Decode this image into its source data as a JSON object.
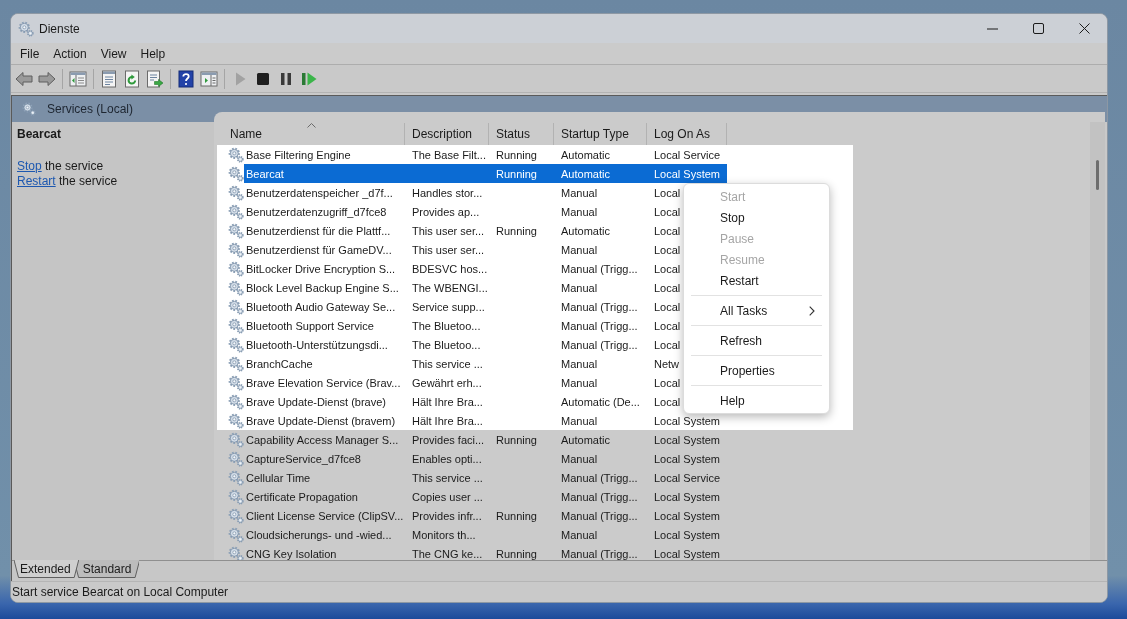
{
  "window": {
    "title": "Dienste"
  },
  "menu_bar": [
    "File",
    "Action",
    "View",
    "Help"
  ],
  "toolbar": {
    "groups": [
      {
        "buttons": [
          {
            "kind": "back",
            "disabled": false
          },
          {
            "kind": "forward",
            "disabled": false
          }
        ]
      },
      {
        "buttons": [
          {
            "kind": "console_tree",
            "disabled": false
          }
        ]
      },
      {
        "buttons": [
          {
            "kind": "properties",
            "disabled": false
          },
          {
            "kind": "refresh",
            "disabled": false
          },
          {
            "kind": "export",
            "disabled": false
          }
        ]
      },
      {
        "buttons": [
          {
            "kind": "help",
            "disabled": false
          },
          {
            "kind": "action_pane",
            "disabled": false
          }
        ]
      },
      {
        "buttons": [
          {
            "kind": "start",
            "disabled": true
          },
          {
            "kind": "stop",
            "disabled": false
          },
          {
            "kind": "pause",
            "disabled": false
          },
          {
            "kind": "restart",
            "disabled": false
          }
        ]
      }
    ]
  },
  "scope_header": {
    "title": "Services (Local)"
  },
  "detail_panel": {
    "title": "Bearcat",
    "actions": [
      {
        "link": "Stop",
        "text": "the service"
      },
      {
        "link": "Restart",
        "text": "the service"
      }
    ]
  },
  "table": {
    "columns": [
      {
        "label": "Name",
        "sorted": true
      },
      {
        "label": "Description",
        "sorted": false
      },
      {
        "label": "Status",
        "sorted": false
      },
      {
        "label": "Startup Type",
        "sorted": false
      },
      {
        "label": "Log On As",
        "sorted": false
      }
    ],
    "rows": [
      {
        "name": "Base Filtering Engine",
        "description": "The Base Filt...",
        "status": "Running",
        "startup_type": "Automatic",
        "log_on_as": "Local Service",
        "selected": false,
        "highlighted": true
      },
      {
        "name": "Bearcat",
        "status": "Running",
        "startup_type": "Automatic",
        "log_on_as": "Local System",
        "selected": true,
        "highlighted": true
      },
      {
        "name": "Benutzerdatenspeicher _d7f...",
        "description": "Handles stor...",
        "startup_type": "Manual",
        "log_on_as": "Local",
        "selected": false,
        "highlighted": true
      },
      {
        "name": "Benutzerdatenzugriff_d7fce8",
        "description": "Provides ap...",
        "startup_type": "Manual",
        "log_on_as": "Local",
        "selected": false,
        "highlighted": true
      },
      {
        "name": "Benutzerdienst für die Plattf...",
        "description": "This user ser...",
        "status": "Running",
        "startup_type": "Automatic",
        "log_on_as": "Local",
        "selected": false,
        "highlighted": true
      },
      {
        "name": "Benutzerdienst für GameDV...",
        "description": "This user ser...",
        "startup_type": "Manual",
        "log_on_as": "Local",
        "selected": false,
        "highlighted": true
      },
      {
        "name": "BitLocker Drive Encryption S...",
        "description": "BDESVC hos...",
        "startup_type": "Manual (Trigg...",
        "log_on_as": "Local",
        "selected": false,
        "highlighted": true
      },
      {
        "name": "Block Level Backup Engine S...",
        "description": "The WBENGI...",
        "startup_type": "Manual",
        "log_on_as": "Local",
        "selected": false,
        "highlighted": true
      },
      {
        "name": "Bluetooth Audio Gateway Se...",
        "description": "Service supp...",
        "startup_type": "Manual (Trigg...",
        "log_on_as": "Local",
        "selected": false,
        "highlighted": true
      },
      {
        "name": "Bluetooth Support Service",
        "description": "The Bluetoo...",
        "startup_type": "Manual (Trigg...",
        "log_on_as": "Local",
        "selected": false,
        "highlighted": true
      },
      {
        "name": "Bluetooth-Unterstützungsdi...",
        "description": "The Bluetoo...",
        "startup_type": "Manual (Trigg...",
        "log_on_as": "Local",
        "selected": false,
        "highlighted": true
      },
      {
        "name": "BranchCache",
        "description": "This service ...",
        "startup_type": "Manual",
        "log_on_as": "Netw",
        "selected": false,
        "highlighted": true
      },
      {
        "name": "Brave Elevation Service (Brav...",
        "description": "Gewährt erh...",
        "startup_type": "Manual",
        "log_on_as": "Local",
        "selected": false,
        "highlighted": true
      },
      {
        "name": "Brave Update-Dienst (brave)",
        "description": "Hält Ihre Bra...",
        "startup_type": "Automatic (De...",
        "log_on_as": "Local",
        "selected": false,
        "highlighted": true
      },
      {
        "name": "Brave Update-Dienst (bravem)",
        "description": "Hält Ihre Bra...",
        "startup_type": "Manual",
        "log_on_as": "Local System",
        "selected": false,
        "highlighted": true
      },
      {
        "name": "Capability Access Manager S...",
        "description": "Provides faci...",
        "status": "Running",
        "startup_type": "Automatic",
        "log_on_as": "Local System",
        "selected": false,
        "highlighted": false
      },
      {
        "name": "CaptureService_d7fce8",
        "description": "Enables opti...",
        "startup_type": "Manual",
        "log_on_as": "Local System",
        "selected": false,
        "highlighted": false
      },
      {
        "name": "Cellular Time",
        "description": "This service ...",
        "startup_type": "Manual (Trigg...",
        "log_on_as": "Local Service",
        "selected": false,
        "highlighted": false
      },
      {
        "name": "Certificate Propagation",
        "description": "Copies user ...",
        "startup_type": "Manual (Trigg...",
        "log_on_as": "Local System",
        "selected": false,
        "highlighted": false
      },
      {
        "name": "Client License Service (ClipSV...",
        "description": "Provides infr...",
        "status": "Running",
        "startup_type": "Manual (Trigg...",
        "log_on_as": "Local System",
        "selected": false,
        "highlighted": false
      },
      {
        "name": "Cloudsicherungs- und -wied...",
        "description": "Monitors th...",
        "startup_type": "Manual",
        "log_on_as": "Local System",
        "selected": false,
        "highlighted": false
      },
      {
        "name": "CNG Key Isolation",
        "description": "The CNG ke...",
        "status": "Running",
        "startup_type": "Manual (Trigg...",
        "log_on_as": "Local System",
        "selected": false,
        "highlighted": false
      }
    ]
  },
  "context_menu": {
    "groups": [
      {
        "items": [
          {
            "label": "Start",
            "disabled": true,
            "submenu": false
          },
          {
            "label": "Stop",
            "disabled": false,
            "submenu": false
          },
          {
            "label": "Pause",
            "disabled": true,
            "submenu": false
          },
          {
            "label": "Resume",
            "disabled": true,
            "submenu": false
          },
          {
            "label": "Restart",
            "disabled": false,
            "submenu": false
          }
        ]
      },
      {
        "items": [
          {
            "label": "All Tasks",
            "disabled": false,
            "submenu": true
          }
        ]
      },
      {
        "items": [
          {
            "label": "Refresh",
            "disabled": false,
            "submenu": false
          }
        ]
      },
      {
        "items": [
          {
            "label": "Properties",
            "disabled": false,
            "submenu": false
          }
        ]
      },
      {
        "items": [
          {
            "label": "Help",
            "disabled": false,
            "submenu": false
          }
        ]
      }
    ]
  },
  "view_tabs": [
    {
      "label": "Extended",
      "selected": true
    },
    {
      "label": "Standard",
      "selected": false
    }
  ],
  "status_bar": {
    "text": "Start service Bearcat on Local Computer"
  }
}
